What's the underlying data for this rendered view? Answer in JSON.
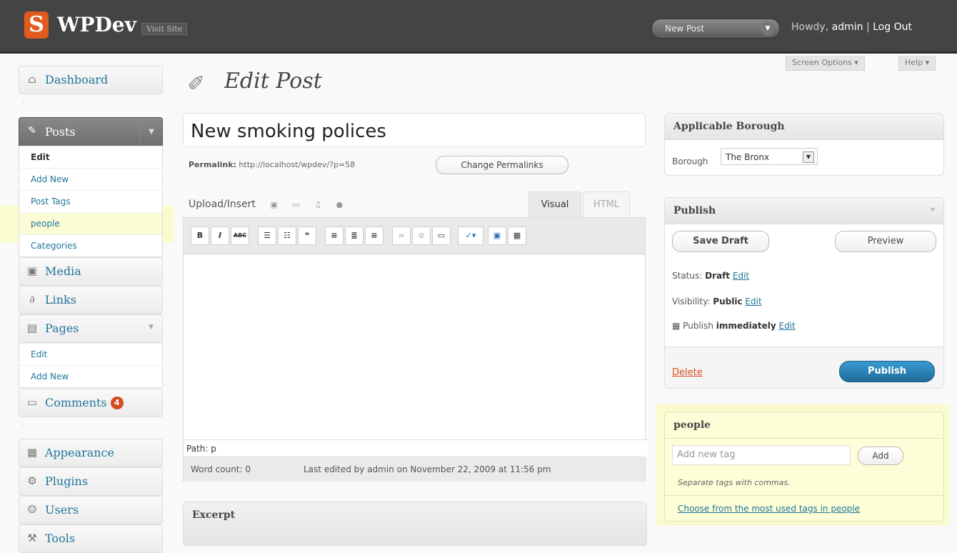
{
  "header": {
    "logo_letter": "S",
    "site_title": "WPDev",
    "visit_site": "Visit Site",
    "new_post_button": "New Post",
    "howdy": "Howdy,",
    "username": "admin",
    "logout": "Log Out"
  },
  "screen_options": "Screen Options",
  "help": "Help",
  "sidebar": {
    "dashboard": "Dashboard",
    "posts": "Posts",
    "posts_sub": [
      "Edit",
      "Add New",
      "Post Tags",
      "people",
      "Categories"
    ],
    "media": "Media",
    "links": "Links",
    "pages": "Pages",
    "pages_sub": [
      "Edit",
      "Add New"
    ],
    "comments": "Comments",
    "comments_count": "4",
    "appearance": "Appearance",
    "plugins": "Plugins",
    "users": "Users",
    "tools": "Tools"
  },
  "main": {
    "page_title": "Edit Post",
    "post_title": "New smoking polices",
    "permalink_label": "Permalink:",
    "permalink_url": "http://localhost/wpdev/?p=58",
    "change_permalinks": "Change Permalinks",
    "upload_insert": "Upload/Insert",
    "tab_visual": "Visual",
    "tab_html": "HTML",
    "path": "Path: p",
    "word_count": "Word count: 0",
    "last_edited": "Last edited by admin on November 22, 2009 at 11:56 pm",
    "excerpt": "Excerpt"
  },
  "borough_box": {
    "title": "Applicable Borough",
    "label": "Borough",
    "value": "The Bronx"
  },
  "publish_box": {
    "title": "Publish",
    "save_draft": "Save Draft",
    "preview": "Preview",
    "status_label": "Status:",
    "status_value": "Draft",
    "visibility_label": "Visibility:",
    "visibility_value": "Public",
    "publish_label": "Publish",
    "publish_value": "immediately",
    "edit": "Edit",
    "delete": "Delete",
    "publish_button": "Publish"
  },
  "people_box": {
    "title": "people",
    "placeholder": "Add new tag",
    "add": "Add",
    "hint": "Separate tags with commas.",
    "choose_link": "Choose from the most used tags in people"
  }
}
